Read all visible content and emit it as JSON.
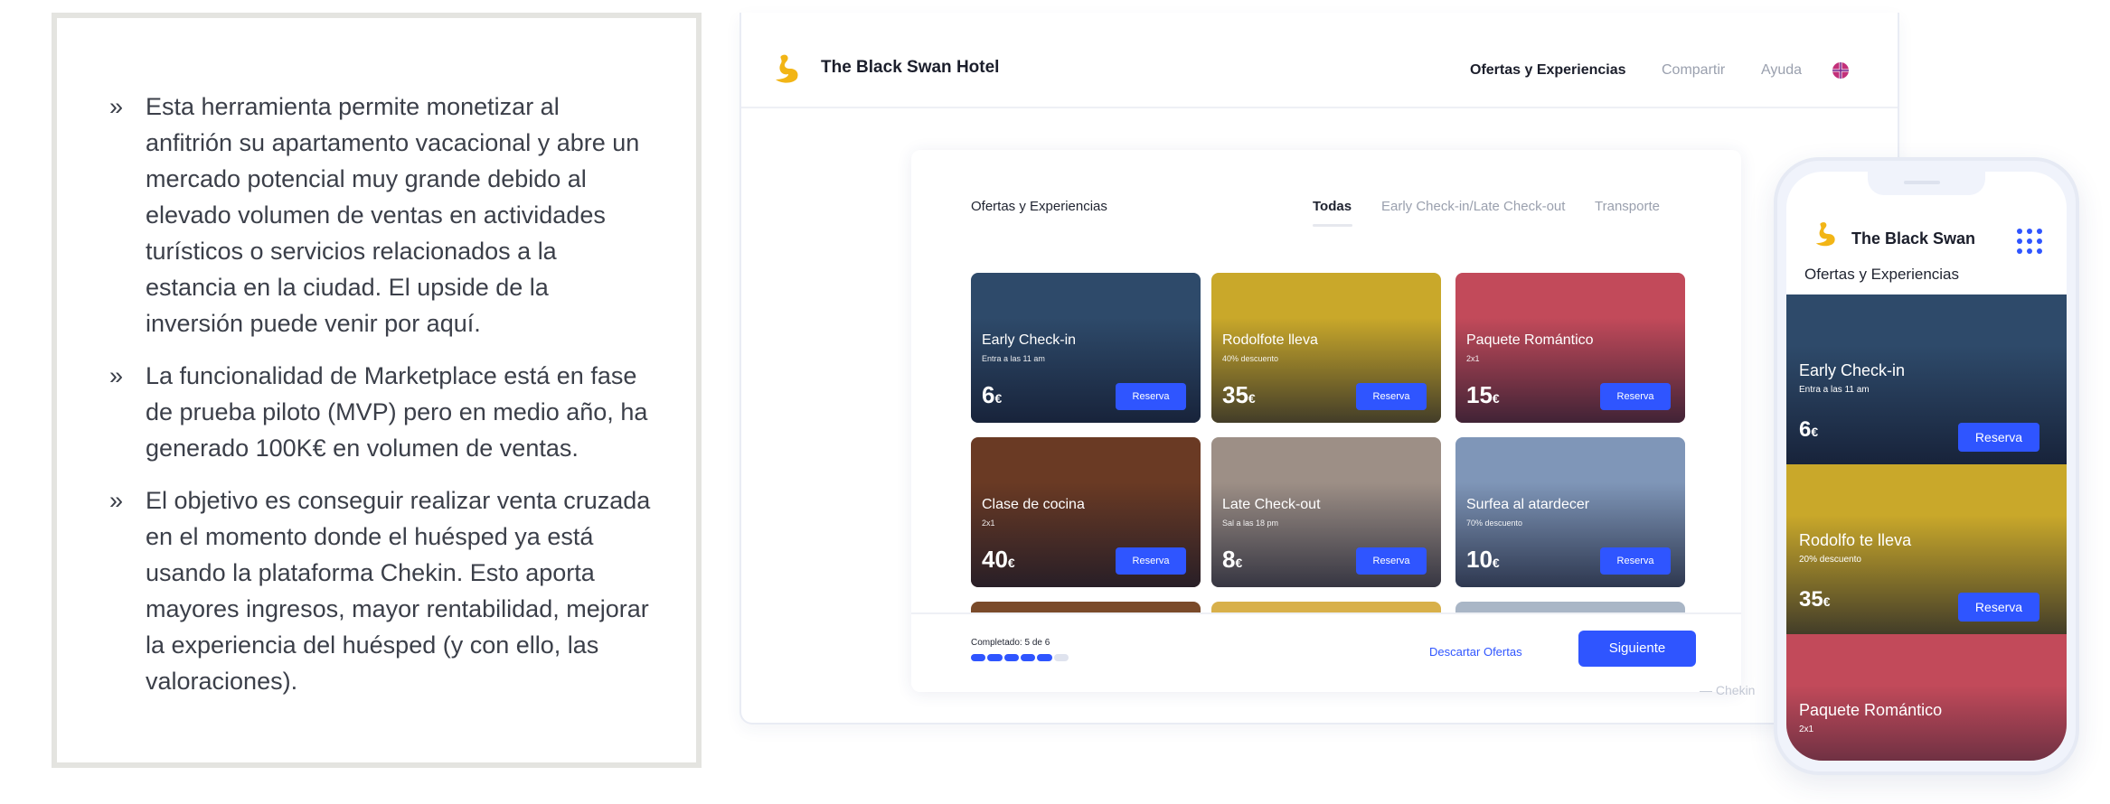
{
  "left_panel": {
    "bullet_marker": "»",
    "bullets": [
      "Esta herramienta permite monetizar al anfitrión su apartamento vacacional y abre un mercado potencial muy grande debido al elevado volumen de ventas en actividades turísticos o servicios relacionados a la estancia en la ciudad. El upside de la inversión puede venir por aquí.",
      "La funcionalidad de Marketplace está en fase de prueba piloto (MVP) pero en medio año, ha generado 100K€ en volumen de ventas.",
      "El objetivo es conseguir realizar venta cruzada en el momento donde el huésped ya está usando la plataforma Chekin. Esto aporta mayores ingresos, mayor rentabilidad, mejorar la experiencia del huésped (y con ello, las valoraciones)."
    ]
  },
  "desktop": {
    "hotel_name": "The Black Swan Hotel",
    "nav": {
      "offers": "Ofertas y Experiencias",
      "share": "Compartir",
      "help": "Ayuda"
    },
    "card": {
      "title": "Ofertas y Experiencias",
      "tabs": {
        "all": "Todas",
        "checkin": "Early Check-in/Late Check-out",
        "transport": "Transporte"
      },
      "offers": [
        {
          "title": "Early Check-in",
          "subtitle": "Entra a las 11 am",
          "price": "6",
          "currency": "€",
          "button": "Reserva",
          "color": "#2e4a6a"
        },
        {
          "title": "Rodolfote lleva",
          "subtitle": "40% descuento",
          "price": "35",
          "currency": "€",
          "button": "Reserva",
          "color": "#c9a82a"
        },
        {
          "title": "Paquete Romántico",
          "subtitle": "2x1",
          "price": "15",
          "currency": "€",
          "button": "Reserva",
          "color": "#c24a5a"
        },
        {
          "title": "Clase de cocina",
          "subtitle": "2x1",
          "price": "40",
          "currency": "€",
          "button": "Reserva",
          "color": "#6a3a24"
        },
        {
          "title": "Late Check-out",
          "subtitle": "Sal a las 18 pm",
          "price": "8",
          "currency": "€",
          "button": "Reserva",
          "color": "#9d8f86"
        },
        {
          "title": "Surfea al atardecer",
          "subtitle": "70% descuento",
          "price": "10",
          "currency": "€",
          "button": "Reserva",
          "color": "#7f96b8"
        }
      ],
      "footer": {
        "progress_label": "Completado: 5 de 6",
        "progress": {
          "done": 5,
          "total": 6
        },
        "discard": "Descartar Ofertas",
        "next": "Siguiente"
      }
    },
    "powered_by": "Chekin"
  },
  "phone": {
    "hotel_name": "The Black Swan",
    "subtitle": "Ofertas y Experiencias",
    "offers": [
      {
        "title": "Early Check-in",
        "subtitle": "Entra a las 11 am",
        "price": "6",
        "currency": "€",
        "button": "Reserva",
        "color": "#2e4a6a"
      },
      {
        "title": "Rodolfo te lleva",
        "subtitle": "20% descuento",
        "price": "35",
        "currency": "€",
        "button": "Reserva",
        "color": "#c9a82a"
      },
      {
        "title": "Paquete Romántico",
        "subtitle": "2x1",
        "price": "",
        "currency": "",
        "button": "",
        "color": "#c24a5a"
      }
    ]
  },
  "colors": {
    "accent": "#2f55ff",
    "logo": "#f2b516"
  }
}
